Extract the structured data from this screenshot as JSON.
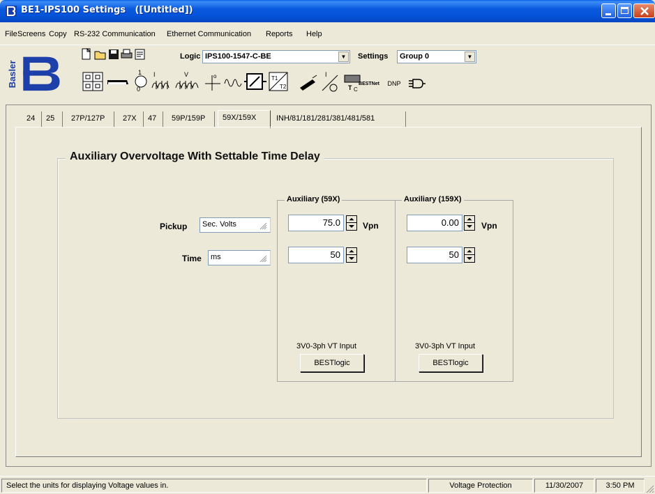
{
  "window": {
    "title": "BE1-IPS100 Settings   ([Untitled])"
  },
  "menu": {
    "items": [
      "File",
      "Screens",
      "Copy",
      "RS-232 Communication",
      "Ethernet Communication",
      "Reports",
      "Help"
    ]
  },
  "toolbar": {
    "logo_text": "Basler",
    "logic_label": "Logic",
    "logic_value": "IPS100-1547-C-BE",
    "settings_label": "Settings",
    "settings_value": "Group 0",
    "bestnet_label": "BESTNet",
    "dnp_label": "DNP"
  },
  "tabs": {
    "items": [
      "24",
      "25",
      "27P/127P",
      "27X",
      "47",
      "59P/159P",
      "59X/159X",
      "INH/81/181/281/381/481/581"
    ],
    "active": "59X/159X"
  },
  "panel": {
    "title": "Auxiliary Overvoltage With Settable Time Delay",
    "pickup_label": "Pickup",
    "pickup_units": "Sec. Volts",
    "time_label": "Time",
    "time_units": "ms",
    "aux59x": {
      "title": "Auxiliary (59X)",
      "pickup_value": "75.0",
      "pickup_unit": "Vpn",
      "time_value": "50",
      "input_label": "3V0-3ph VT Input",
      "button_label": "BESTlogic"
    },
    "aux159x": {
      "title": "Auxiliary (159X)",
      "pickup_value": "0.00",
      "pickup_unit": "Vpn",
      "time_value": "50",
      "input_label": "3V0-3ph VT Input",
      "button_label": "BESTlogic"
    }
  },
  "status": {
    "message": "Select the units for displaying Voltage values in.",
    "section": "Voltage Protection",
    "date": "11/30/2007",
    "time": "3:50 PM"
  },
  "colors": {
    "titlebar": "#0a5ae0",
    "window_bg": "#ece9d8",
    "close_button": "#c8401c"
  }
}
